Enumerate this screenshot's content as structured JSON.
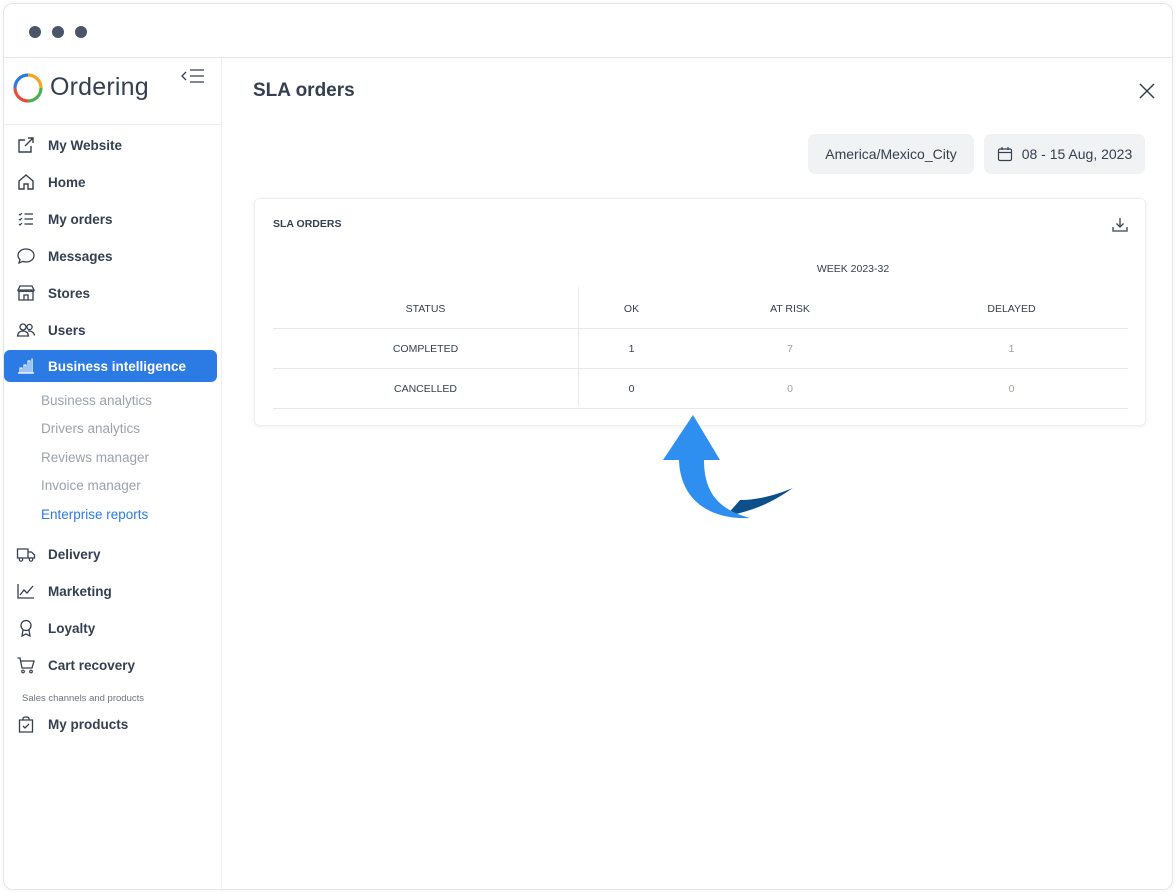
{
  "brand": {
    "name": "Ordering"
  },
  "sidebar": {
    "items": [
      {
        "label": "My Website",
        "icon": "external-link-icon"
      },
      {
        "label": "Home",
        "icon": "home-icon"
      },
      {
        "label": "My orders",
        "icon": "list-icon"
      },
      {
        "label": "Messages",
        "icon": "chat-icon"
      },
      {
        "label": "Stores",
        "icon": "store-icon"
      },
      {
        "label": "Users",
        "icon": "users-icon"
      },
      {
        "label": "Business intelligence",
        "icon": "bar-chart-icon",
        "active": true
      },
      {
        "label": "Delivery",
        "icon": "truck-icon"
      },
      {
        "label": "Marketing",
        "icon": "line-chart-icon"
      },
      {
        "label": "Loyalty",
        "icon": "award-icon"
      },
      {
        "label": "Cart recovery",
        "icon": "cart-icon"
      },
      {
        "label": "My products",
        "icon": "bag-check-icon"
      }
    ],
    "subitems": [
      {
        "label": "Business analytics"
      },
      {
        "label": "Drivers analytics"
      },
      {
        "label": "Reviews manager"
      },
      {
        "label": "Invoice manager"
      },
      {
        "label": "Enterprise reports",
        "current": true
      }
    ],
    "section_label": "Sales channels and products"
  },
  "main": {
    "title": "SLA orders",
    "timezone": "America/Mexico_City",
    "date_range": "08 - 15 Aug, 2023",
    "card": {
      "title": "SLA ORDERS",
      "week": "WEEK 2023-32",
      "headers": [
        "STATUS",
        "OK",
        "AT RISK",
        "DELAYED"
      ],
      "rows": [
        [
          "COMPLETED",
          "1",
          "7",
          "1"
        ],
        [
          "CANCELLED",
          "0",
          "0",
          "0"
        ]
      ]
    }
  },
  "colors": {
    "accent": "#2c7be5",
    "text": "#344050",
    "muted": "#9aa3ad",
    "arrow_light": "#2e8ff0",
    "arrow_dark": "#0d4f8b"
  }
}
